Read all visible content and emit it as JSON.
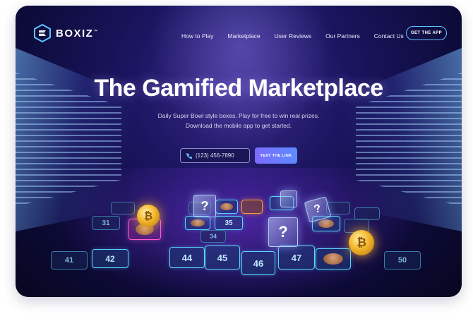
{
  "brand": {
    "name": "BOXIZ",
    "trademark": "™",
    "logo_icon": "boxiz-logo-icon"
  },
  "nav": {
    "links": [
      "How to Play",
      "Marketplace",
      "User Reviews",
      "Our Partners",
      "Contact Us"
    ],
    "cta_label": "GET THE APP"
  },
  "hero": {
    "title": "The Gamified Marketplace",
    "subtitle": "Daily Super Bowl style boxes. Play for free to win real prizes. Download the mobile app to get started.",
    "phone_placeholder": "(123) 456-7890",
    "phone_icon": "phone-icon",
    "submit_label": "TEXT THE LINK"
  },
  "board": {
    "tile_numbers": [
      "41",
      "42",
      "44",
      "45",
      "46",
      "47",
      "50",
      "31",
      "35",
      "34"
    ],
    "cube_symbol": "?",
    "coin_symbol": "₿"
  },
  "colors": {
    "accent": "#5fc4ff",
    "button_start": "#7b6bff",
    "button_end": "#5d8bff",
    "background": "#0d0b3a"
  }
}
